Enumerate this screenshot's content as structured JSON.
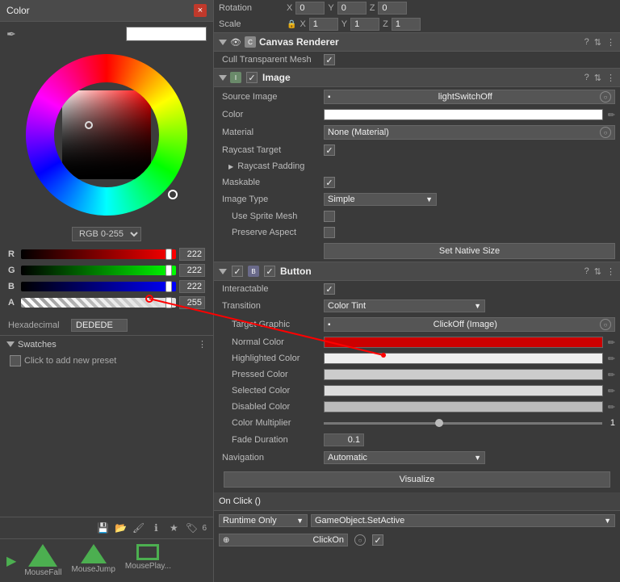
{
  "colorPicker": {
    "title": "Color",
    "closeBtn": "×",
    "rgbMode": "RGB 0-255",
    "sliders": {
      "r": {
        "label": "R",
        "value": "222"
      },
      "g": {
        "label": "G",
        "value": "222"
      },
      "b": {
        "label": "B",
        "value": "222"
      },
      "a": {
        "label": "A",
        "value": "255"
      }
    },
    "hexLabel": "Hexadecimal",
    "hexValue": "DEDEDE",
    "swatches": {
      "title": "Swatches",
      "addPreset": "Click to add new preset"
    }
  },
  "inspector": {
    "rotation": {
      "label": "Rotation",
      "x": "0",
      "y": "0",
      "z": "0"
    },
    "scale": {
      "label": "Scale",
      "x": "1",
      "y": "1",
      "z": "1"
    },
    "canvasRenderer": {
      "title": "Canvas Renderer",
      "cullLabel": "Cull Transparent Mesh"
    },
    "image": {
      "title": "Image",
      "sourceImageLabel": "Source Image",
      "sourceImageValue": "lightSwitchOff",
      "colorLabel": "Color",
      "materialLabel": "Material",
      "materialValue": "None (Material)",
      "raycastTargetLabel": "Raycast Target",
      "raycastPaddingLabel": "Raycast Padding",
      "maskableLabel": "Maskable",
      "imageTypeLabel": "Image Type",
      "imageTypeValue": "Simple",
      "useSpriteMeshLabel": "Use Sprite Mesh",
      "preserveAspectLabel": "Preserve Aspect",
      "setNativeSizeBtn": "Set Native Size"
    },
    "button": {
      "title": "Button",
      "interactableLabel": "Interactable",
      "transitionLabel": "Transition",
      "transitionValue": "Color Tint",
      "targetGraphicLabel": "Target Graphic",
      "targetGraphicValue": "ClickOff (Image)",
      "normalColorLabel": "Normal Color",
      "highlightedColorLabel": "Highlighted Color",
      "pressedColorLabel": "Pressed Color",
      "selectedColorLabel": "Selected Color",
      "disabledColorLabel": "Disabled Color",
      "colorMultiplierLabel": "Color Multiplier",
      "colorMultiplierValue": "1",
      "fadeDurationLabel": "Fade Duration",
      "fadeDurationValue": "0.1",
      "navigationLabel": "Navigation",
      "navigationValue": "Automatic",
      "visualizeBtn": "Visualize"
    },
    "onClick": {
      "title": "On Click ()",
      "runtimeOnly": "Runtime Only",
      "method": "GameObject.SetActive",
      "objectValue": "ClickOn"
    }
  },
  "sceneItems": [
    {
      "label": "MouseFall"
    },
    {
      "label": "MouseJump"
    },
    {
      "label": "MousePlay..."
    }
  ],
  "icons": {
    "close": "×",
    "eyedropper": "✏",
    "questionMark": "?",
    "settings": "≡",
    "menu": "⋮",
    "eye": "👁",
    "lock": "🔒"
  }
}
